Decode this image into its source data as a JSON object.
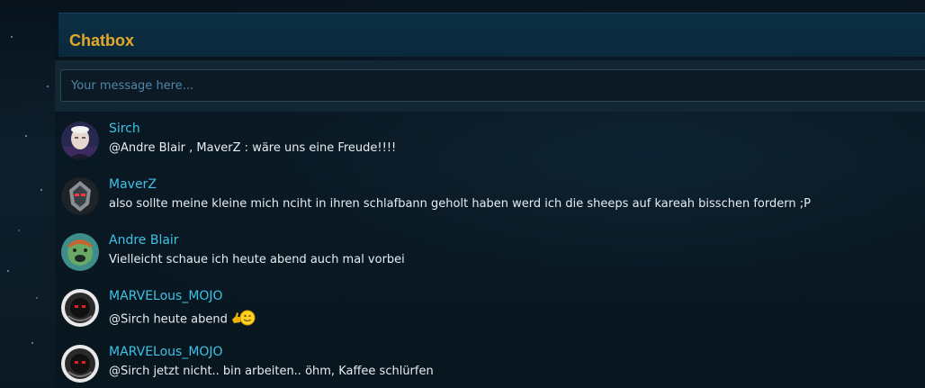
{
  "chatbox": {
    "title": "Chatbox",
    "input_placeholder": "Your message here..."
  },
  "messages": [
    {
      "user": "Sirch",
      "text": "@Andre Blair , MaverZ : wäre uns eine Freude!!!!",
      "avatar": "sirch-avatar"
    },
    {
      "user": "MaverZ",
      "text": "also sollte meine kleine mich nciht in ihren schlafbann geholt haben werd ich die sheeps auf kareah bisschen fordern ;P",
      "avatar": "maverz-avatar"
    },
    {
      "user": "Andre Blair",
      "text": "Vielleicht schaue ich heute abend auch mal vorbei",
      "avatar": "andre-blair-avatar"
    },
    {
      "user": "MARVELous_MOJO",
      "text": "@Sirch heute abend",
      "avatar": "marvelous-mojo-avatar",
      "emoji": "thumbs-up-wink-emoji"
    },
    {
      "user": "MARVELous_MOJO",
      "text": "@Sirch jetzt nicht.. bin arbeiten.. öhm, Kaffee schlürfen",
      "avatar": "marvelous-mojo-avatar"
    }
  ],
  "colors": {
    "title": "#e3a82a",
    "username": "#3cc3e6",
    "message_text": "#e7edf1",
    "header_bg": "#0c2f44"
  }
}
